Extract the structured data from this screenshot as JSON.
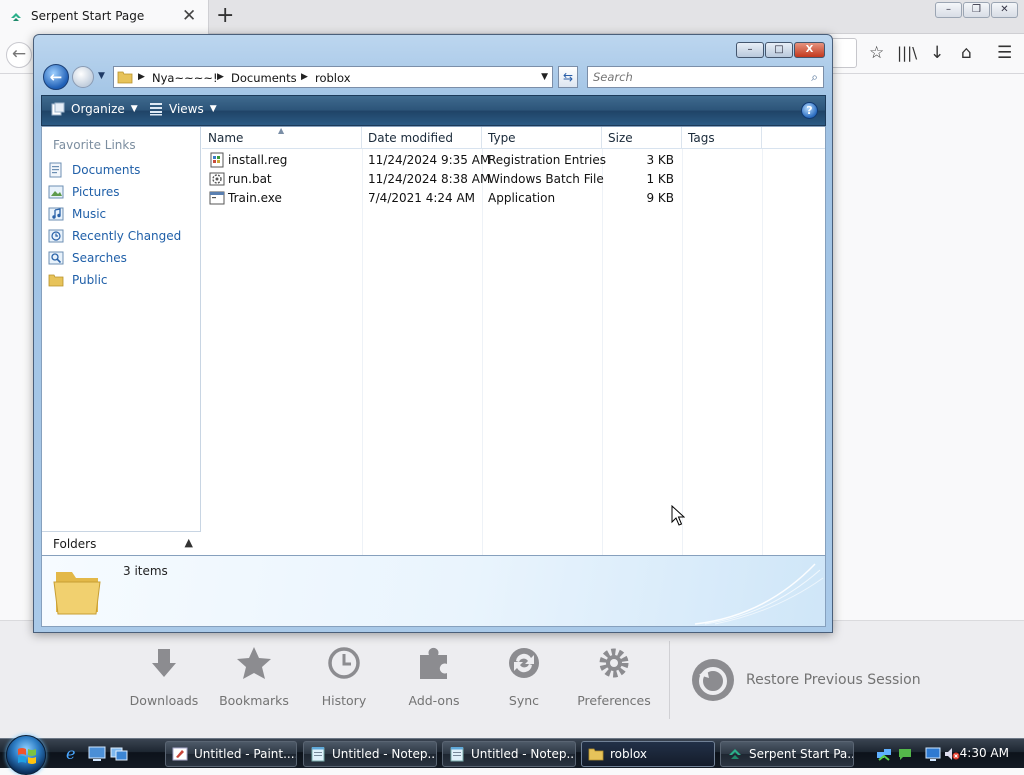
{
  "browser": {
    "tab_title": "Serpent Start Page",
    "tab_close": "✕",
    "new_tab": "+",
    "window_buttons": [
      "–",
      "❒",
      "✕"
    ],
    "footer": {
      "items": [
        {
          "label": "Downloads"
        },
        {
          "label": "Bookmarks"
        },
        {
          "label": "History"
        },
        {
          "label": "Add-ons"
        },
        {
          "label": "Sync"
        },
        {
          "label": "Preferences"
        }
      ],
      "restore_label": "Restore Previous Session"
    }
  },
  "explorer": {
    "window_buttons": {
      "min": "–",
      "max": "□",
      "close": "X"
    },
    "breadcrumb": [
      "Nya~~~~!",
      "Documents",
      "roblox"
    ],
    "search_placeholder": "Search",
    "toolbar": {
      "organize": "Organize",
      "views": "Views",
      "help": "?"
    },
    "nav": {
      "header": "Favorite Links",
      "items": [
        {
          "label": "Documents",
          "icon": "documents-icon"
        },
        {
          "label": "Pictures",
          "icon": "pictures-icon"
        },
        {
          "label": "Music",
          "icon": "music-icon"
        },
        {
          "label": "Recently Changed",
          "icon": "recently-changed-icon"
        },
        {
          "label": "Searches",
          "icon": "searches-icon"
        },
        {
          "label": "Public",
          "icon": "public-folder-icon"
        }
      ],
      "folders_label": "Folders"
    },
    "columns": [
      "Name",
      "Date modified",
      "Type",
      "Size",
      "Tags"
    ],
    "files": [
      {
        "name": "install.reg",
        "date": "11/24/2024 9:35 AM",
        "type": "Registration Entries",
        "size": "3 KB",
        "tags": "",
        "icon": "registry-file-icon"
      },
      {
        "name": "run.bat",
        "date": "11/24/2024 8:38 AM",
        "type": "Windows Batch File",
        "size": "1 KB",
        "tags": "",
        "icon": "batch-file-icon"
      },
      {
        "name": "Train.exe",
        "date": "7/4/2021 4:24 AM",
        "type": "Application",
        "size": "9 KB",
        "tags": "",
        "icon": "application-icon"
      }
    ],
    "details": {
      "count": "3 items"
    }
  },
  "taskbar": {
    "buttons": [
      {
        "label": "Untitled - Paint....",
        "icon": "paint-icon",
        "active": false
      },
      {
        "label": "Untitled - Notep...",
        "icon": "notepad-icon",
        "active": false
      },
      {
        "label": "Untitled - Notep...",
        "icon": "notepad-icon",
        "active": false
      },
      {
        "label": "roblox",
        "icon": "folder-icon",
        "active": true
      },
      {
        "label": "Serpent Start Pa...",
        "icon": "serpent-browser-icon",
        "active": false
      }
    ],
    "clock": "4:30 AM"
  }
}
